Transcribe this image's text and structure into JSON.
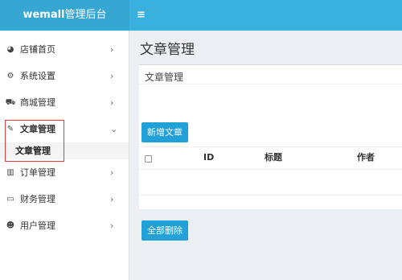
{
  "brand": {
    "bold": "wemall",
    "rest": "管理后台"
  },
  "header": {
    "toggle_icon": "≡"
  },
  "sidebar": {
    "items": [
      {
        "label": "店铺首页",
        "icon": "dashboard-icon",
        "glyph": "◕",
        "chevron": "›"
      },
      {
        "label": "系统设置",
        "icon": "cogs-icon",
        "glyph": "⚙",
        "chevron": "›"
      },
      {
        "label": "商城管理",
        "icon": "cart-icon",
        "glyph": "⛟",
        "chevron": "›"
      },
      {
        "label": "文章管理",
        "icon": "edit-icon",
        "glyph": "✎",
        "chevron": "⌄",
        "active": true
      },
      {
        "label": "订单管理",
        "icon": "bar-chart-icon",
        "glyph": "▥",
        "chevron": "›"
      },
      {
        "label": "财务管理",
        "icon": "credit-card-icon",
        "glyph": "▭",
        "chevron": "›"
      },
      {
        "label": "用户管理",
        "icon": "users-icon",
        "glyph": "☻",
        "chevron": "›"
      }
    ],
    "submenu": {
      "label": "文章管理"
    }
  },
  "main": {
    "page_title": "文章管理",
    "box_title": "文章管理",
    "add_button": "新增文章",
    "delete_all_button": "全部删除",
    "table": {
      "columns": [
        "ID",
        "标题",
        "作者"
      ]
    }
  },
  "colors": {
    "accent": "#3ab0df",
    "button": "#22a0d8",
    "highlight_box": "#e23b3b"
  }
}
